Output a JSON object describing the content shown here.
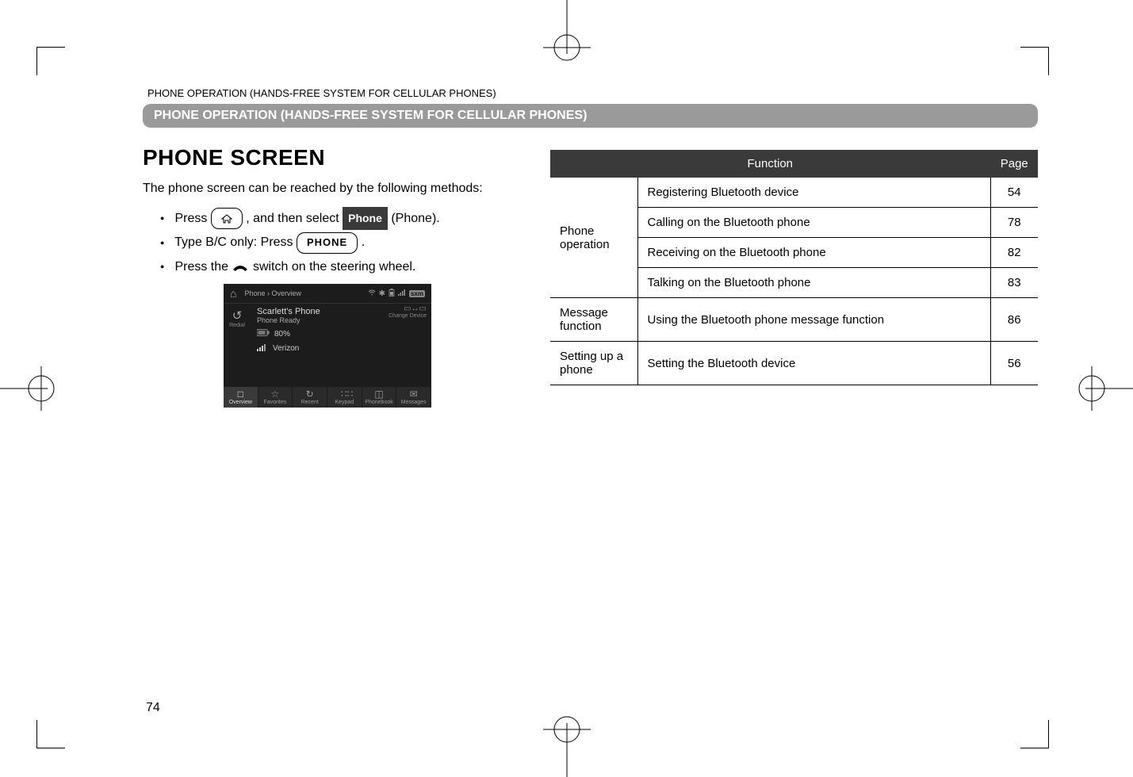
{
  "breadcrumb": "PHONE OPERATION (HANDS-FREE SYSTEM FOR CELLULAR PHONES)",
  "sectionBar": "PHONE OPERATION (HANDS-FREE SYSTEM FOR CELLULAR PHONES)",
  "heading": "PHONE SCREEN",
  "intro": "The phone screen can be reached by the following methods:",
  "bullets": {
    "b1_pre": "Press ",
    "b1_mid": ", and then select ",
    "b1_badge": "Phone",
    "b1_post": " (Phone).",
    "b2_pre": "Type B/C only: Press ",
    "b2_pill": "PHONE",
    "b2_post": ".",
    "b3_pre": "Press the ",
    "b3_post": " switch on the steering wheel."
  },
  "screenshot": {
    "crumb": "Phone › Overview",
    "sxm": "sxm",
    "redial": "Redial",
    "devName": "Scarlett's Phone",
    "devStatus": "Phone Ready",
    "battery": "80%",
    "carrier": "Verizon",
    "change": "Change Device",
    "bottom": [
      "Overview",
      "Favorites",
      "Recent",
      "Keypad",
      "Phonebook",
      "Messages"
    ],
    "bottomIcons": [
      "□",
      "☆",
      "↻",
      " ∷∷",
      "◫",
      "✉"
    ]
  },
  "tableHeaders": {
    "function": "Function",
    "page": "Page"
  },
  "rows": [
    {
      "group": "Phone operation",
      "func": "Registering Bluetooth device",
      "page": "54"
    },
    {
      "func": "Calling on the Bluetooth phone",
      "page": "78"
    },
    {
      "func": "Receiving on the Bluetooth phone",
      "page": "82"
    },
    {
      "func": "Talking on the Bluetooth phone",
      "page": "83"
    },
    {
      "group": "Message function",
      "func": "Using the Bluetooth phone message function",
      "page": "86"
    },
    {
      "group": "Setting up a phone",
      "func": "Setting the Bluetooth device",
      "page": "56"
    }
  ],
  "pageNumber": "74"
}
